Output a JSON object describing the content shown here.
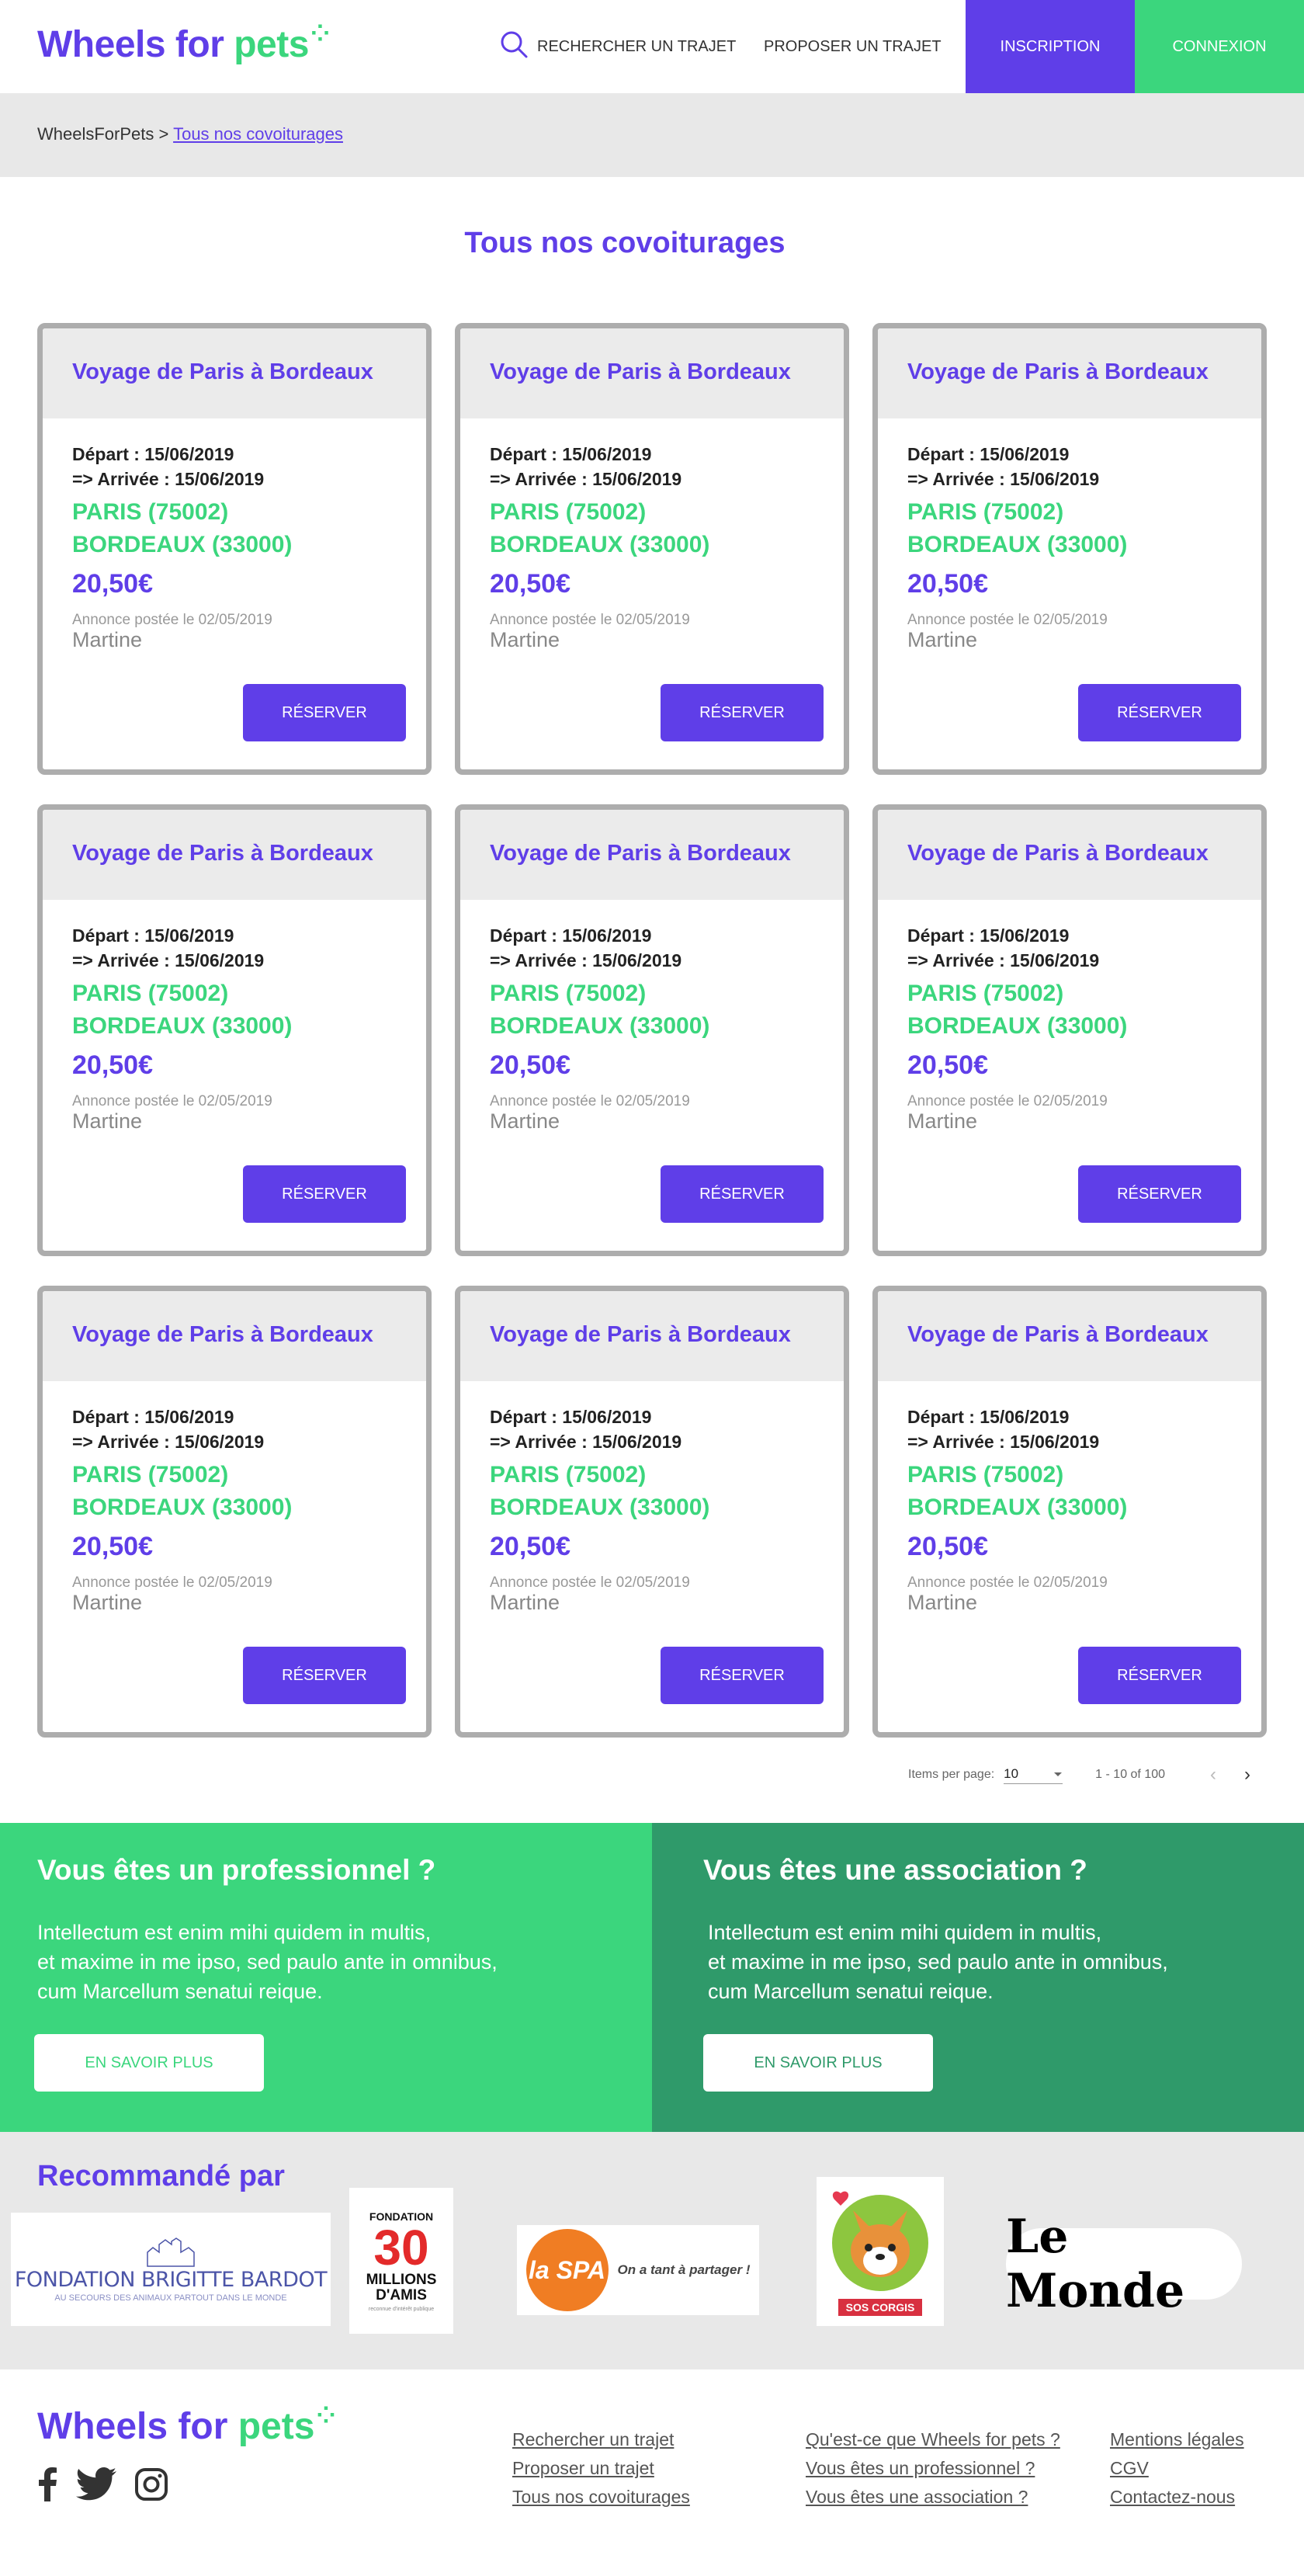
{
  "header": {
    "logo_main": "Wheels for ",
    "logo_accent": "pets",
    "search_label": "RECHERCHER UN TRAJET",
    "propose_label": "PROPOSER UN TRAJET",
    "inscription_label": "INSCRIPTION",
    "connexion_label": "CONNEXION"
  },
  "breadcrumb": {
    "root": "WheelsForPets",
    "separator": " > ",
    "current": "Tous nos covoiturages"
  },
  "page_title": "Tous nos covoiturages",
  "cards": [
    {
      "title": "Voyage de Paris à Bordeaux",
      "depart": "Départ : 15/06/2019",
      "arrivee": "=> Arrivée : 15/06/2019",
      "from": "PARIS (75002)",
      "to": "BORDEAUX (33000)",
      "price": "20,50€",
      "posted": "Annonce postée le 02/05/2019",
      "author": "Martine",
      "button": "RÉSERVER"
    },
    {
      "title": "Voyage de Paris à Bordeaux",
      "depart": "Départ : 15/06/2019",
      "arrivee": "=> Arrivée : 15/06/2019",
      "from": "PARIS (75002)",
      "to": "BORDEAUX (33000)",
      "price": "20,50€",
      "posted": "Annonce postée le 02/05/2019",
      "author": "Martine",
      "button": "RÉSERVER"
    },
    {
      "title": "Voyage de Paris à Bordeaux",
      "depart": "Départ : 15/06/2019",
      "arrivee": "=> Arrivée : 15/06/2019",
      "from": "PARIS (75002)",
      "to": "BORDEAUX (33000)",
      "price": "20,50€",
      "posted": "Annonce postée le 02/05/2019",
      "author": "Martine",
      "button": "RÉSERVER"
    },
    {
      "title": "Voyage de Paris à Bordeaux",
      "depart": "Départ : 15/06/2019",
      "arrivee": "=> Arrivée : 15/06/2019",
      "from": "PARIS (75002)",
      "to": "BORDEAUX (33000)",
      "price": "20,50€",
      "posted": "Annonce postée le 02/05/2019",
      "author": "Martine",
      "button": "RÉSERVER"
    },
    {
      "title": "Voyage de Paris à Bordeaux",
      "depart": "Départ : 15/06/2019",
      "arrivee": "=> Arrivée : 15/06/2019",
      "from": "PARIS (75002)",
      "to": "BORDEAUX (33000)",
      "price": "20,50€",
      "posted": "Annonce postée le 02/05/2019",
      "author": "Martine",
      "button": "RÉSERVER"
    },
    {
      "title": "Voyage de Paris à Bordeaux",
      "depart": "Départ : 15/06/2019",
      "arrivee": "=> Arrivée : 15/06/2019",
      "from": "PARIS (75002)",
      "to": "BORDEAUX (33000)",
      "price": "20,50€",
      "posted": "Annonce postée le 02/05/2019",
      "author": "Martine",
      "button": "RÉSERVER"
    },
    {
      "title": "Voyage de Paris à Bordeaux",
      "depart": "Départ : 15/06/2019",
      "arrivee": "=> Arrivée : 15/06/2019",
      "from": "PARIS (75002)",
      "to": "BORDEAUX (33000)",
      "price": "20,50€",
      "posted": "Annonce postée le 02/05/2019",
      "author": "Martine",
      "button": "RÉSERVER"
    },
    {
      "title": "Voyage de Paris à Bordeaux",
      "depart": "Départ : 15/06/2019",
      "arrivee": "=> Arrivée : 15/06/2019",
      "from": "PARIS (75002)",
      "to": "BORDEAUX (33000)",
      "price": "20,50€",
      "posted": "Annonce postée le 02/05/2019",
      "author": "Martine",
      "button": "RÉSERVER"
    },
    {
      "title": "Voyage de Paris à Bordeaux",
      "depart": "Départ : 15/06/2019",
      "arrivee": "=> Arrivée : 15/06/2019",
      "from": "PARIS (75002)",
      "to": "BORDEAUX (33000)",
      "price": "20,50€",
      "posted": "Annonce postée le 02/05/2019",
      "author": "Martine",
      "button": "RÉSERVER"
    }
  ],
  "pagination": {
    "items_label": "Items per page:",
    "items_value": "10",
    "range": "1 - 10 of 100"
  },
  "cta": {
    "pro_title": "Vous êtes un professionnel ?",
    "pro_text_1": "Intellectum est enim mihi quidem in multis,",
    "pro_text_2": "et maxime in me ipso, sed paulo ante in omnibus,",
    "pro_text_3": "cum Marcellum senatui reique.",
    "pro_button": "EN SAVOIR PLUS",
    "asso_title": "Vous êtes une association ?",
    "asso_text_1": "Intellectum est enim mihi quidem in multis,",
    "asso_text_2": "et maxime in me ipso, sed paulo ante in omnibus,",
    "asso_text_3": "cum Marcellum senatui reique.",
    "asso_button": "EN SAVOIR PLUS"
  },
  "recommended": {
    "title": "Recommandé par",
    "partners": {
      "bardot_name": "FONDATION BRIGITTE BARDOT",
      "bardot_sub": "AU SECOURS DES ANIMAUX PARTOUT DANS LE MONDE",
      "millions_top": "FONDATION",
      "millions_num": "30",
      "millions_name": "MILLIONS D'AMIS",
      "millions_sub": "reconnue d'intérêt publique",
      "spa_name": "la SPA",
      "spa_tag": "On a tant à partager !",
      "corgis_name": "SOS CORGIS",
      "monde_name": "Le Monde"
    }
  },
  "footer": {
    "logo_main": "Wheels for ",
    "logo_accent": "pets",
    "col1": [
      "Rechercher un trajet",
      "Proposer un trajet",
      "Tous nos covoiturages"
    ],
    "col2": [
      "Qu'est-ce que Wheels for pets ?",
      "Vous êtes un professionnel ?",
      "Vous êtes une association ?"
    ],
    "col3": [
      "Mentions légales",
      "CGV",
      "Contactez-nous"
    ]
  },
  "colors": {
    "primary": "#5f3ee8",
    "green": "#3bd67d",
    "dark_green": "#2f9a6a",
    "grey_bg": "#e8e8e8"
  },
  "icons": [
    "search-icon",
    "facebook-icon",
    "twitter-icon",
    "instagram-icon",
    "chevron-left-icon",
    "chevron-right-icon",
    "dropdown-arrow-icon"
  ]
}
